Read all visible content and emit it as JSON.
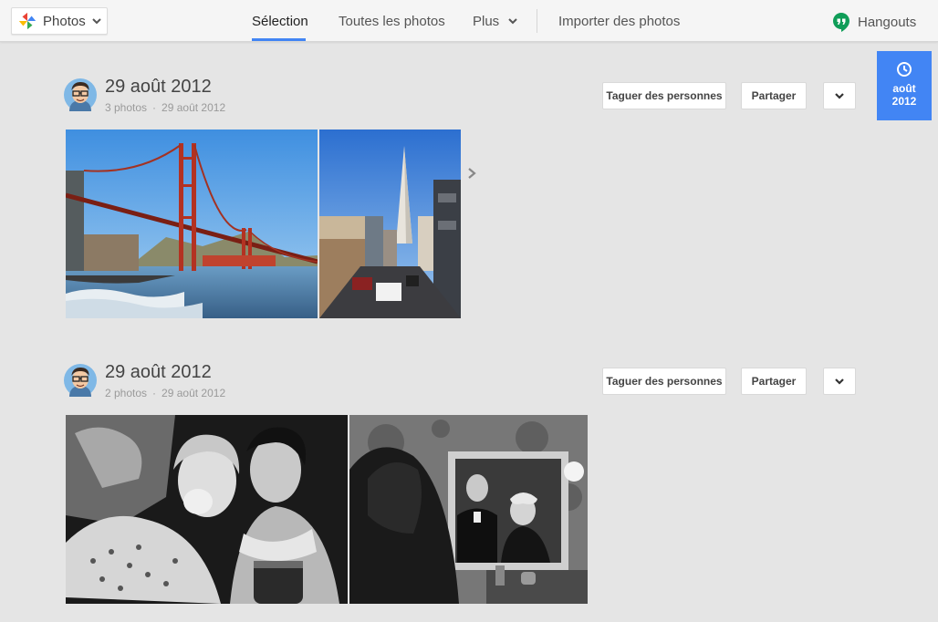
{
  "app": {
    "switcher_label": "Photos"
  },
  "nav": {
    "items": [
      {
        "label": "Sélection",
        "active": true
      },
      {
        "label": "Toutes les photos",
        "active": false
      },
      {
        "label": "Plus",
        "active": false
      },
      {
        "label": "Importer des photos",
        "active": false
      }
    ],
    "hangouts_label": "Hangouts"
  },
  "date_badge": {
    "month": "août",
    "year": "2012"
  },
  "albums": [
    {
      "title": "29 août 2012",
      "count": "3 photos",
      "date": "29 août 2012",
      "tag_label": "Taguer des personnes",
      "share_label": "Partager"
    },
    {
      "title": "29 août 2012",
      "count": "2 photos",
      "date": "29 août 2012",
      "tag_label": "Taguer des personnes",
      "share_label": "Partager"
    }
  ],
  "colors": {
    "accent": "#4285f4",
    "hangouts_green": "#0f9d58",
    "background": "#e5e5e5"
  }
}
